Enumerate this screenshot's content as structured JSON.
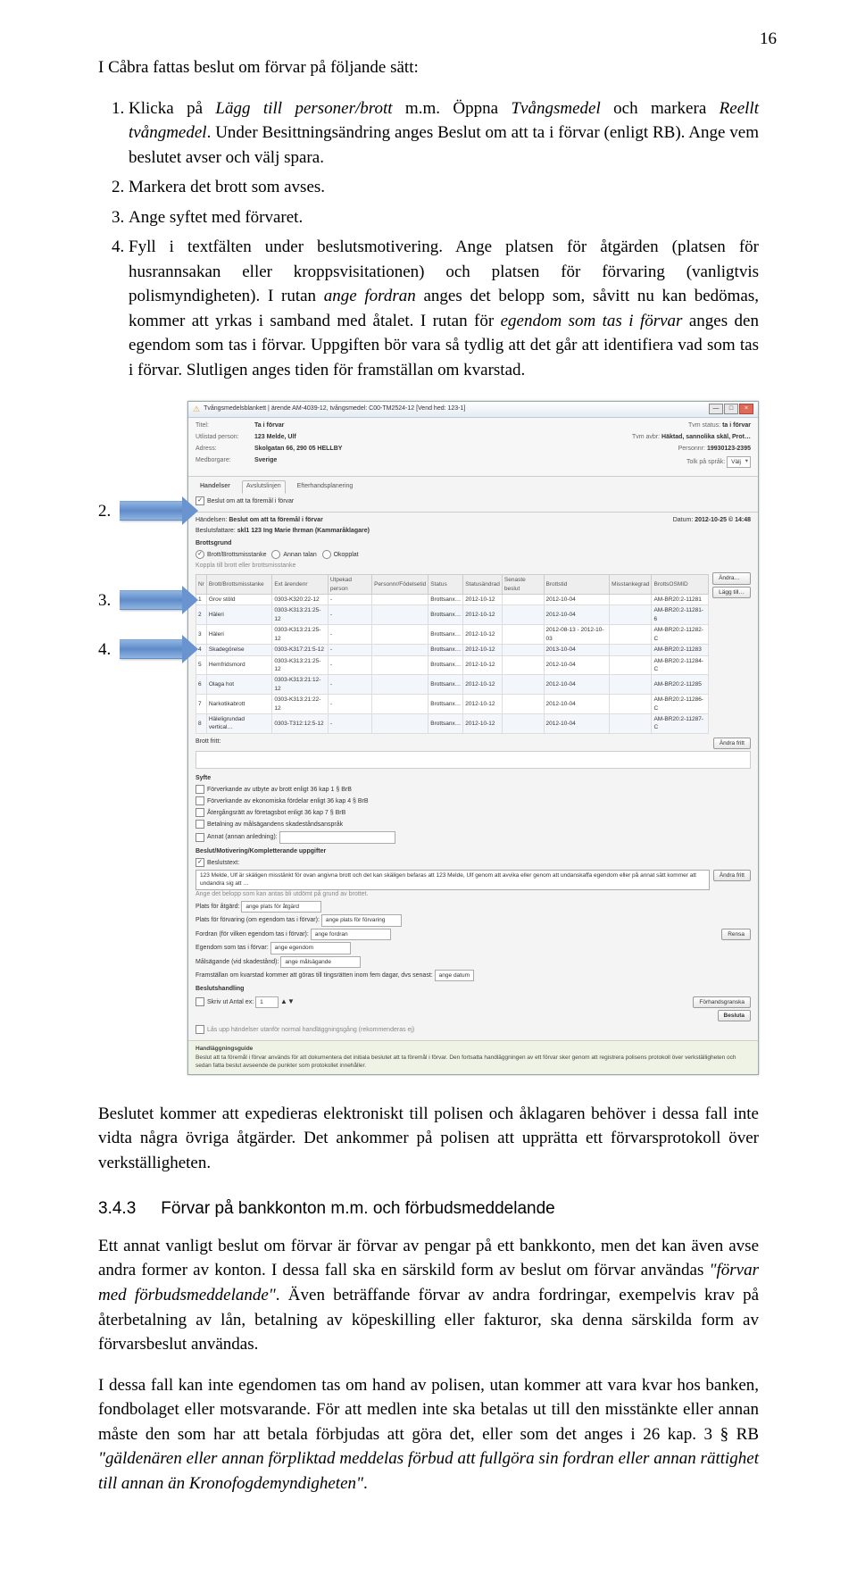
{
  "page_number": "16",
  "intro": "I Cåbra fattas beslut om förvar på följande sätt:",
  "list_items": [
    {
      "plain_a": "Klicka på ",
      "em_a": "Lägg till personer/brott",
      "plain_b": " m.m. Öppna ",
      "em_b": "Tvångsmedel",
      "plain_c": " och markera ",
      "em_c": "Reellt tvångmedel",
      "plain_d": ". Under Besittningsändring anges Beslut om att ta i förvar (enligt RB). Ange vem beslutet avser och välj spara."
    },
    {
      "text": "Markera det brott som avses."
    },
    {
      "text": "Ange syftet med förvaret."
    },
    {
      "long_a": "Fyll i textfälten under beslutsmotivering. Ange platsen för åtgärden (platsen för husrannsakan eller kroppsvisitationen) och platsen för förvaring (vanligtvis polismyndigheten). I rutan ",
      "em_a": "ange fordran",
      "long_b": " anges det belopp som, såvitt nu kan bedömas, kommer att yrkas i samband med åtalet.  I rutan för ",
      "em_b": "egendom som tas i förvar",
      "long_c": " anges den egendom som tas i förvar. Uppgiften bör vara så tydlig att det går att identifiera vad som tas i förvar. Slutligen anges tiden för framställan om kvarstad."
    }
  ],
  "arrow_nums": [
    "2.",
    "3.",
    "4."
  ],
  "ss": {
    "title": "Tvångsmedelsblankett | ärende AM-4039-12, tvångsmedel: C00-TM2524-12  [Vend hed: 123-1]",
    "titlebtn_min": "—",
    "titlebtn_max": "□",
    "titlebtn_close": "×",
    "header": {
      "titel_lbl": "Titel:",
      "titel_val": "Ta i förvar",
      "tvm_lbl": "Tvm status:",
      "tvm_val": "ta i förvar",
      "pers_lbl": "Utlistad person:",
      "pers_val": "123 Melde, Ulf",
      "tvm_avbr_lbl": "Tvm avbr:",
      "tvm_avbr_val": "Häktad, sannolika skäl, Prot…",
      "adr_lbl": "Adress:",
      "adr_val": "Skolgatan 66, 290 05  HELLBY",
      "persnr_lbl": "Personnr:",
      "persnr_val": "19930123-2395",
      "medb_lbl": "Medborgare:",
      "medb_val": "Sverige",
      "tolk_lbl": "Tolk på språk:",
      "tolk_sel": "Välj"
    },
    "tabs": {
      "t1": "Handelser",
      "t2": "Avslutslinjen",
      "t3": "Efterhandsplanering"
    },
    "handelser_lbl": "Handelser",
    "beslut_check": "Beslut om att ta föremål i förvar",
    "handelsen_lbl": "Händelsen:",
    "handelsen_val": "Beslut om att ta föremål i förvar",
    "datum_lbl": "Datum:",
    "datum_val": "2012-10-25   © 14:48",
    "fattare_lbl": "Beslutsfattare:",
    "fattare_val": "skl1 123  Ing Marie Ihrman (Kammaråklagare)",
    "brottsgrund_lbl": "Brottsgrund",
    "radio1": "Brott/Brottsmisstanke",
    "radio2": "Annan talan",
    "radio3": "Okopplat",
    "koppla": "Koppla till brott eller brottsmisstanke",
    "thead": [
      "Nr",
      "Brott/Brottsmisstanke",
      "Ext ärendenr",
      "Utpekad person",
      "Personnr/Födelsetid",
      "Status",
      "Statusändrad",
      "Senaste beslut",
      "Brottstid",
      "Misstankegrad",
      "BrottsOSMID"
    ],
    "rows": [
      [
        "1",
        "Grov stöld",
        "0303-K320:22-12",
        "-",
        "",
        "Brottsanx…",
        "2012-10-12",
        "",
        "2012-10-04",
        "",
        "AM-BR20:2-11281"
      ],
      [
        "2",
        "Häleri",
        "0303-K313:21:25-12",
        "-",
        "",
        "Brottsanx…",
        "2012-10-12",
        "",
        "2012-10-04",
        "",
        "AM-BR20:2-11281-6"
      ],
      [
        "3",
        "Häleri",
        "0303-K313:21:25-12",
        "-",
        "",
        "Brottsanx…",
        "2012-10-12",
        "",
        "2012-08-13 - 2012-10-03",
        "",
        "AM-BR20:2-11282-C"
      ],
      [
        "4",
        "Skadegörelse",
        "0303-K317:21:5-12",
        "-",
        "",
        "Brottsanx…",
        "2012-10-12",
        "",
        "2013-10-04",
        "",
        "AM-BR20:2-11283"
      ],
      [
        "5",
        "Hemfridsmord",
        "0303-K313:21:25-12",
        "-",
        "",
        "Brottsanx…",
        "2012-10-12",
        "",
        "2012-10-04",
        "",
        "AM-BR20:2-11284-C"
      ],
      [
        "6",
        "Olaga hot",
        "0303-K313:21:12-12",
        "-",
        "",
        "Brottsanx…",
        "2012-10-12",
        "",
        "2012-10-04",
        "",
        "AM-BR20:2-11285"
      ],
      [
        "7",
        "Narkotikabrott",
        "0303-K313:21:22-12",
        "-",
        "",
        "Brottsanx…",
        "2012-10-12",
        "",
        "2012-10-04",
        "",
        "AM-BR20:2-11286-C"
      ],
      [
        "8",
        "Häleligrundad vertical…",
        "0303-T312:12:5-12",
        "-",
        "",
        "Brottsanx…",
        "2012-10-12",
        "",
        "2012-10-04",
        "",
        "AM-BR20:2-11287-C"
      ]
    ],
    "andra_btn": "Ändra…",
    "laggtill_btn": "Lägg till…",
    "brottfritt_lbl": "Brott fritt:",
    "andrafritt_btn": "Ändra fritt",
    "syfte_lbl": "Syfte",
    "syfte1": "Förverkande av utbyte av brott enligt 36 kap 1 § BrB",
    "syfte2": "Förverkande av ekonomiska fördelar enligt 36 kap 4 § BrB",
    "syfte3": "Återgångsrätt av företagsbot enligt 36 kap 7 § BrB",
    "syfte4": "Betalning av målsägandens skadeståndsanspråk",
    "syfte5": "Annat (annan anledning):",
    "komp_lbl": "Beslut/Motivering/Kompletterande uppgifter",
    "besltxt": "Beslutstext:",
    "motiv_long": "123 Melde, Ulf  är skäligen misstänkt för ovan angivna brott och det kan skäligen befaras att  123 Melde, Ulf  genom att avvika eller genom att undanskaffa egendom eller på annat sätt kommer att undandra sig att …",
    "plats_at": "Plats för åtgärd:",
    "plats_at_v": "ange plats för åtgärd",
    "belopp": "Ange det belopp som kan antas bli utdömt på grund av brottet.",
    "plats_fv": "Plats för förvaring (om egendom tas i förvar):",
    "plats_fv_v": "ange plats för förvaring",
    "fordran": "Fordran (för vilken egendom tas i förvar):",
    "fordran_v": "ange fordran",
    "rensa_btn": "Rensa",
    "egendom": "Egendom som tas i förvar:",
    "egendom_v": "ange egendom",
    "malsagande": "Målsägande (vid skadestånd):",
    "malsagande_v": "ange målsägande",
    "framst": "Framställan om kvarstad kommer att göras till tingsrätten inom fem dagar, dvs senast:",
    "framst_v": "ange datum",
    "besluthand": "Beslutshandling",
    "skrivut": "Skriv ut    Antal ex: ",
    "antal": "1",
    "forhandsgr": "Förhandsgranska",
    "beslutabtn": "Besluta",
    "lasupp": "Lås upp händelser utanför normal handläggningsgång (rekommenderas ej)",
    "guide_lbl": "Handläggningsguide",
    "guide_txt": "Beslut att ta föremål i förvar används för att dokumentera det initiala beslutet att ta föremål i förvar. Den fortsatta handläggningen av ett förvar sker genom att registrera polisens protokoll över verkställigheten och sedan fatta beslut avseende de punkter som protokollet innehåller."
  },
  "after1": "Beslutet kommer att expedieras elektroniskt till polisen och åklagaren behöver i dessa fall inte vidta några övriga åtgärder. Det ankommer på polisen att upprätta ett förvarsprotokoll över verkställigheten.",
  "h3_no": "3.4.3",
  "h3_txt": "Förvar på bankkonton m.m. och förbudsmeddelande",
  "after2_a": "Ett annat vanligt beslut om förvar är förvar av pengar på ett bankkonto, men det kan även avse andra former av konton. I dessa fall ska en särskild form av beslut om förvar användas ",
  "after2_q": "\"förvar med förbudsmeddelande\"",
  "after2_b": ". Även beträffande förvar av andra fordringar, exempelvis krav på återbetalning av lån, betalning av köpeskilling eller fakturor, ska denna särskilda form av förvarsbeslut användas.",
  "after3_a": "I dessa fall kan inte egendomen tas om hand av polisen, utan kommer att vara kvar hos banken, fondbolaget eller motsvarande. För att medlen inte ska betalas ut till den misstänkte eller annan måste den som har att betala förbjudas att göra det, eller som det anges i 26 kap. 3 § RB ",
  "after3_q": "\"gäldenären eller annan förpliktad meddelas förbud att fullgöra sin fordran eller annan rättighet till annan än Kronofogdemyndigheten\"",
  "after3_b": "."
}
